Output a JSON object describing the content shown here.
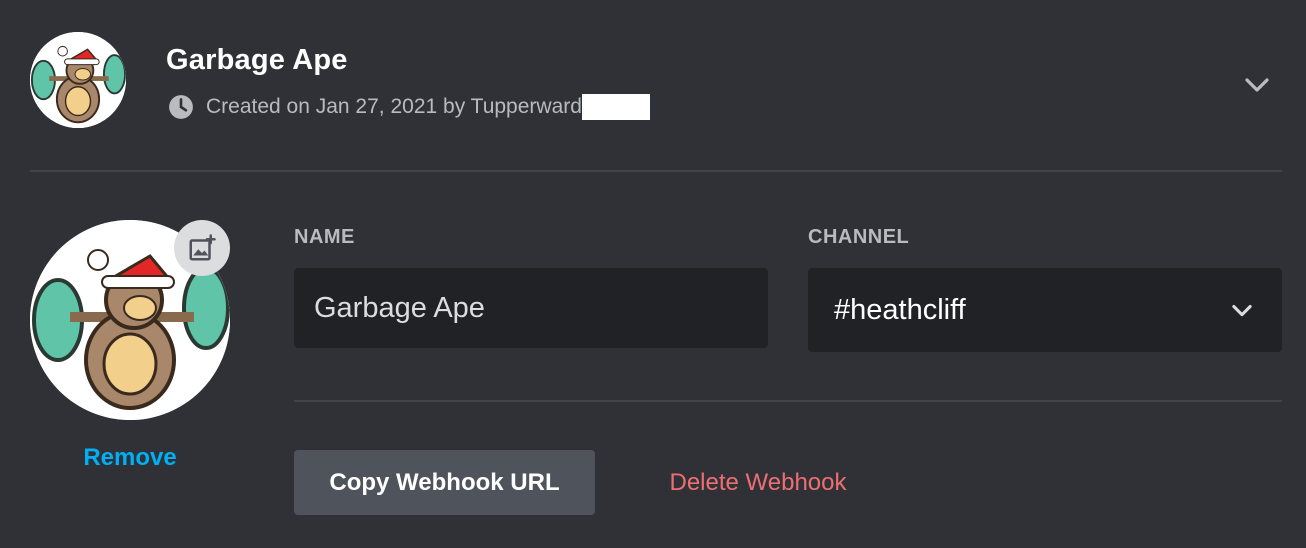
{
  "webhook": {
    "title": "Garbage Ape",
    "created_text": "Created on Jan 27, 2021 by Tupperward"
  },
  "icons": {
    "meta": "clock-icon",
    "expand": "chevron-down-icon",
    "upload": "image-add-icon",
    "channel_dropdown": "chevron-down-icon"
  },
  "avatar": {
    "remove_label": "Remove"
  },
  "form": {
    "name_label": "NAME",
    "name_value": "Garbage Ape",
    "channel_label": "CHANNEL",
    "channel_value": "#heathcliff"
  },
  "actions": {
    "copy_label": "Copy Webhook URL",
    "delete_label": "Delete Webhook"
  },
  "colors": {
    "background": "#2f3136",
    "input_bg": "#202225",
    "link": "#00aff4",
    "danger": "#ed6f72",
    "secondary_button": "#4f545c"
  }
}
